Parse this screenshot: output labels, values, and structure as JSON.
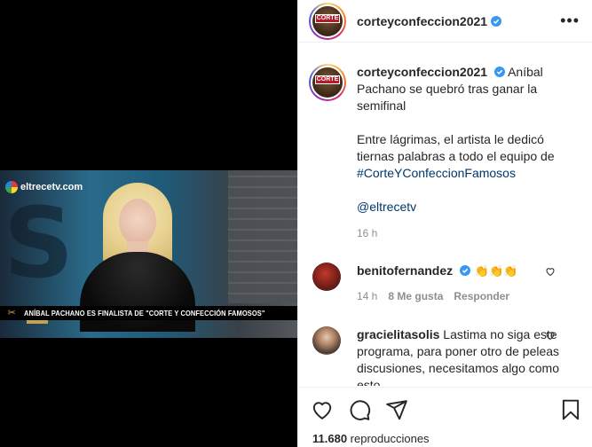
{
  "media": {
    "channel_logo": "eltrecetv.com",
    "lower_third": "ANÍBAL PACHANO ES FINALISTA DE \"CORTE Y CONFECCIÓN FAMOSOS\""
  },
  "post": {
    "username": "corteyconfeccion2021",
    "avatar_text": "CORTE",
    "more_icon": "more-horizontal-icon",
    "caption": {
      "username": "corteyconfeccion2021",
      "line1": "Aníbal Pachano se quebró tras ganar la semifinal",
      "line2": "Entre lágrimas, el artista le dedicó tiernas palabras a todo el equipo de",
      "hashtag": "#CorteYConfeccionFamosos",
      "mention": "@eltrecetv",
      "time": "16 h"
    },
    "comments": [
      {
        "username": "benitofernandez",
        "text": "👏👏👏",
        "time": "14 h",
        "likes": "8 Me gusta",
        "reply": "Responder"
      },
      {
        "username": "gracielitasolis",
        "text": "Lastima no siga este programa, para poner otro de peleas discusiones, necesitamos algo como esto"
      }
    ],
    "views_count": "11.680",
    "views_label": "reproducciones"
  },
  "colors": {
    "verified": "#3897f0",
    "link": "#00376b",
    "muted": "#8e8e8e"
  }
}
